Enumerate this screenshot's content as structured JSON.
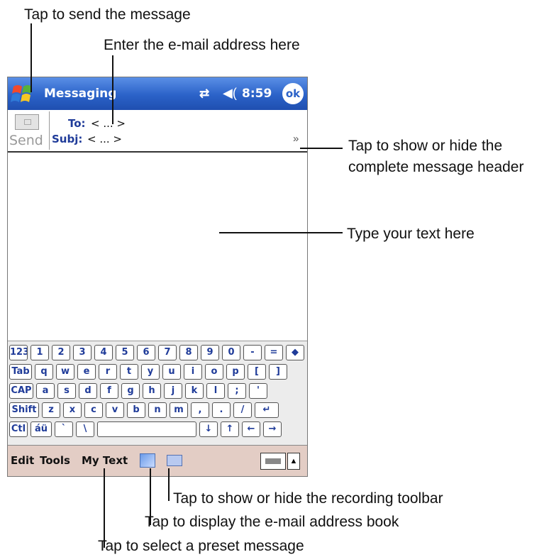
{
  "callouts": {
    "send": "Tap to send the message",
    "address": "Enter the e-mail address here",
    "header_toggle_line1": "Tap to show or hide the",
    "header_toggle_line2": "complete message header",
    "body_text": "Type your text here",
    "recording": "Tap to show or hide the recording toolbar",
    "address_book": "Tap to display the e-mail address book",
    "preset": "Tap to select a preset message"
  },
  "titlebar": {
    "app_title": "Messaging",
    "time": "8:59",
    "ok_label": "ok",
    "icons": [
      "start-flag-icon",
      "connectivity-icon",
      "volume-icon"
    ]
  },
  "header": {
    "send_label": "Send",
    "to_label": "To:",
    "to_value": "< ... >",
    "subj_label": "Subj:",
    "subj_value": "< ... >",
    "expand_symbol": "»"
  },
  "keyboard": {
    "rows": [
      [
        "123",
        "1",
        "2",
        "3",
        "4",
        "5",
        "6",
        "7",
        "8",
        "9",
        "0",
        "-",
        "=",
        "◆"
      ],
      [
        "Tab",
        "q",
        "w",
        "e",
        "r",
        "t",
        "y",
        "u",
        "i",
        "o",
        "p",
        "[",
        "]"
      ],
      [
        "CAP",
        "a",
        "s",
        "d",
        "f",
        "g",
        "h",
        "j",
        "k",
        "l",
        ";",
        "'"
      ],
      [
        "Shift",
        "z",
        "x",
        "c",
        "v",
        "b",
        "n",
        "m",
        ",",
        ".",
        "/",
        "↵"
      ],
      [
        "Ctl",
        "áü",
        "`",
        "\\",
        "",
        "↓",
        "↑",
        "←",
        "→"
      ]
    ]
  },
  "menubar": {
    "items": [
      "Edit",
      "Tools",
      "My Text"
    ],
    "input_arrow": "▲"
  },
  "colors": {
    "titlebar": "#2b62c8",
    "menubar": "#e3cdc5",
    "field_label": "#1f3b99"
  }
}
